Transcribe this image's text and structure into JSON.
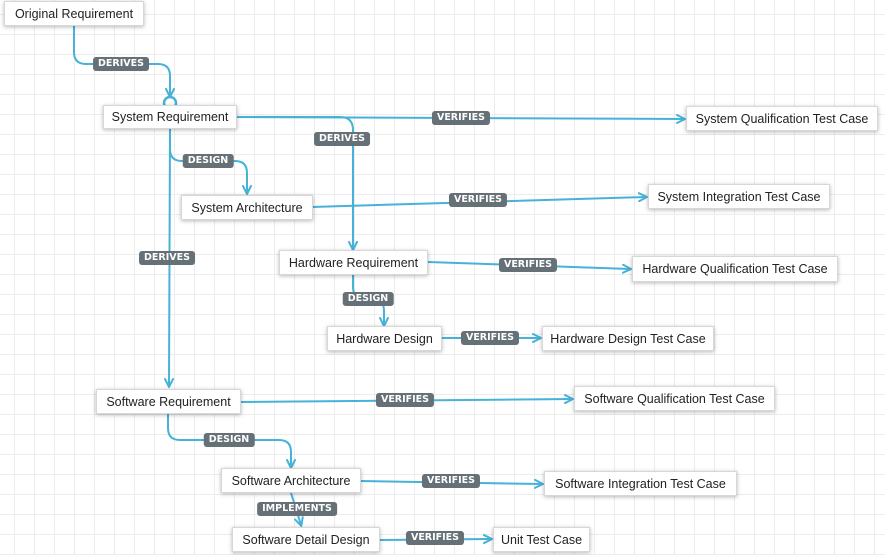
{
  "colors": {
    "edge": "#46b2d8",
    "label_bg": "#667077"
  },
  "nodes": {
    "original_requirement": "Original Requirement",
    "system_requirement": "System Requirement",
    "system_qualification_test_case": "System Qualification Test Case",
    "system_architecture": "System Architecture",
    "system_integration_test_case": "System Integration Test Case",
    "hardware_requirement": "Hardware Requirement",
    "hardware_qualification_test_case": "Hardware Qualification Test Case",
    "hardware_design": "Hardware Design",
    "hardware_design_test_case": "Hardware Design Test Case",
    "software_requirement": "Software Requirement",
    "software_qualification_test_case": "Software Qualification Test Case",
    "software_architecture": "Software Architecture",
    "software_integration_test_case": "Software Integration Test Case",
    "software_detail_design": "Software Detail Design",
    "unit_test_case": "Unit Test Case"
  },
  "edges": {
    "derives_original_system": "DERIVES",
    "verifies_system_qualification": "VERIFIES",
    "derives_system_hardware": "DERIVES",
    "design_system_architecture": "DESIGN",
    "verifies_system_integration": "VERIFIES",
    "derives_system_software": "DERIVES",
    "verifies_hardware_qualification": "VERIFIES",
    "design_hardware": "DESIGN",
    "verifies_hardware_design": "VERIFIES",
    "verifies_software_qualification": "VERIFIES",
    "design_software_architecture": "DESIGN",
    "verifies_software_integration": "VERIFIES",
    "implements_software_detail": "IMPLEMENTS",
    "verifies_unit_test": "VERIFIES"
  }
}
